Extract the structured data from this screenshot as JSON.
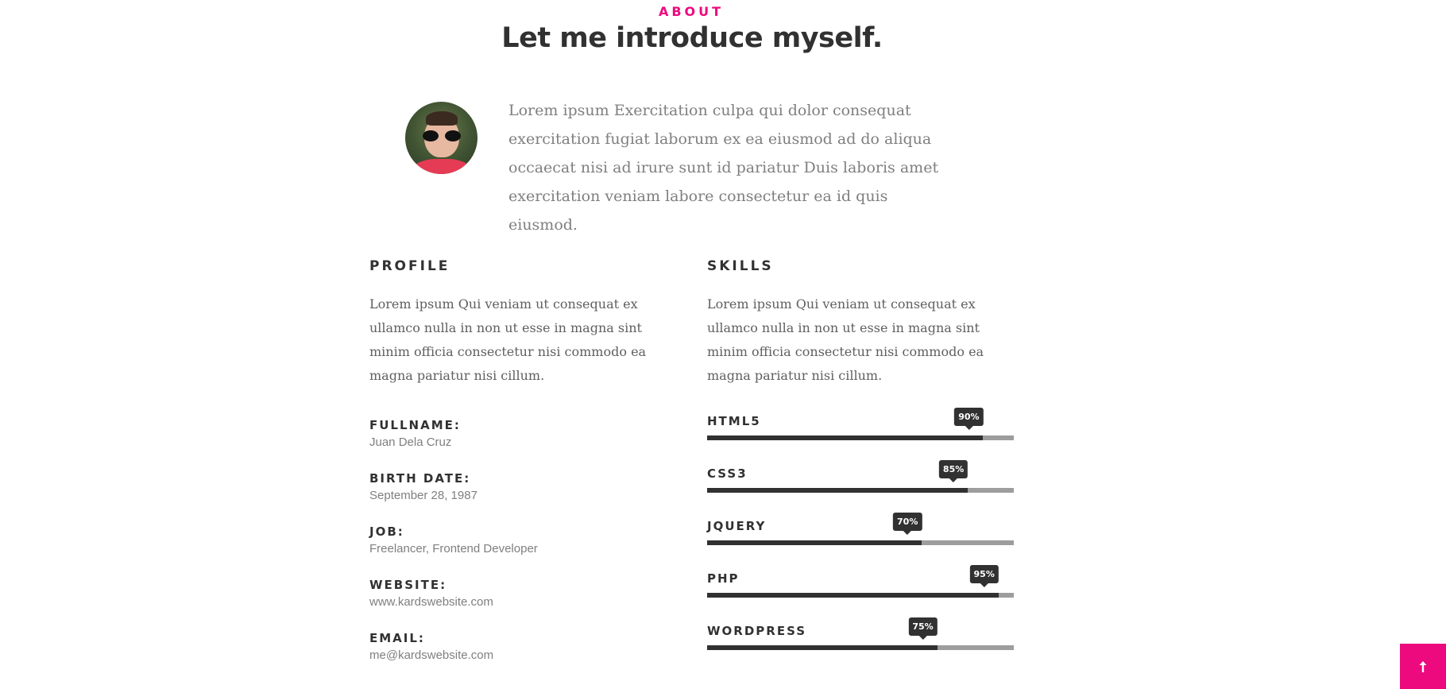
{
  "section": {
    "label": "ABOUT",
    "title": "Let me introduce myself.",
    "intro": "Lorem ipsum Exercitation culpa qui dolor consequat exercitation fugiat laborum ex ea eiusmod ad do aliqua occaecat nisi ad irure sunt id pariatur Duis laboris amet exercitation veniam labore consectetur ea id quis eiusmod."
  },
  "profile": {
    "title": "PROFILE",
    "text": "Lorem ipsum Qui veniam ut consequat ex ullamco nulla in non ut esse in magna sint minim officia consectetur nisi commodo ea magna pariatur nisi cillum.",
    "items": [
      {
        "label": "FULLNAME:",
        "value": "Juan Dela Cruz"
      },
      {
        "label": "BIRTH DATE:",
        "value": "September 28, 1987"
      },
      {
        "label": "JOB:",
        "value": "Freelancer, Frontend Developer"
      },
      {
        "label": "WEBSITE:",
        "value": "www.kardswebsite.com"
      },
      {
        "label": "EMAIL:",
        "value": "me@kardswebsite.com"
      }
    ]
  },
  "skills": {
    "title": "SKILLS",
    "text": "Lorem ipsum Qui veniam ut consequat ex ullamco nulla in non ut esse in magna sint minim officia consectetur nisi commodo ea magna pariatur nisi cillum.",
    "items": [
      {
        "name": "HTML5",
        "percent": 90,
        "label": "90%"
      },
      {
        "name": "CSS3",
        "percent": 85,
        "label": "85%"
      },
      {
        "name": "JQUERY",
        "percent": 70,
        "label": "70%"
      },
      {
        "name": "PHP",
        "percent": 95,
        "label": "95%"
      },
      {
        "name": "WORDPRESS",
        "percent": 75,
        "label": "75%"
      }
    ]
  },
  "icons": {
    "back_to_top": "arrow-up-icon"
  },
  "colors": {
    "accent": "#ec0a7e",
    "dark": "#313131",
    "track": "#9d9d9d"
  }
}
